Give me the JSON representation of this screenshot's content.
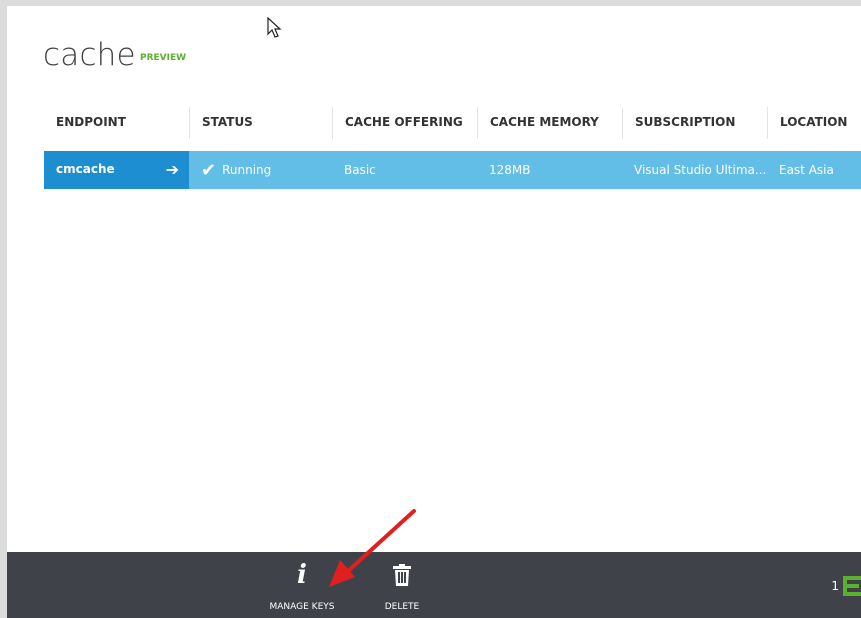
{
  "page": {
    "title": "cache",
    "badge": "PREVIEW"
  },
  "table": {
    "columns": [
      "ENDPOINT",
      "STATUS",
      "CACHE OFFERING",
      "CACHE MEMORY",
      "SUBSCRIPTION",
      "LOCATION"
    ],
    "rows": [
      {
        "endpoint": "cmcache",
        "status": "Running",
        "cache_offering": "Basic",
        "cache_memory": "128MB",
        "subscription": "Visual Studio Ultima...",
        "location": "East Asia"
      }
    ]
  },
  "commands": {
    "manage_keys": "MANAGE KEYS",
    "delete": "DELETE"
  },
  "pager": {
    "count": "1"
  },
  "colors": {
    "row_bg": "#62bee6",
    "endpoint_bg": "#1d8fd0",
    "command_bar": "#3f4349",
    "preview_green": "#5cb030",
    "annotation_arrow": "#e02020"
  },
  "icons": [
    "arrow-right-icon",
    "checkmark-icon",
    "info-icon",
    "trash-icon",
    "list-icon",
    "mouse-cursor-icon"
  ]
}
